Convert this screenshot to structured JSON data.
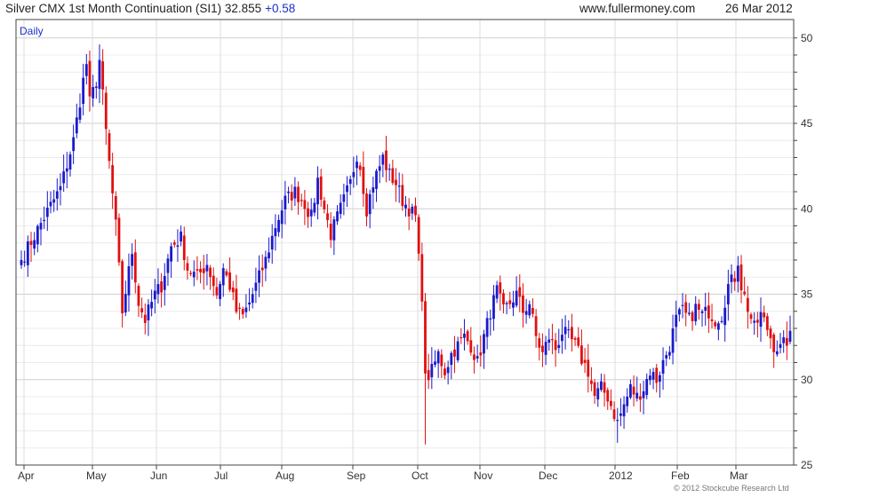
{
  "header": {
    "title": "Silver CMX 1st Month Continuation (SI1) 32.855",
    "change": "+0.58",
    "site": "www.fullermoney.com",
    "date": "26 Mar 2012"
  },
  "period_label": "Daily",
  "copyright": "© 2012 Stockcube Research Ltd",
  "colors": {
    "up": "#1a1acc",
    "down": "#e01010",
    "grid": "#dddddd",
    "frame": "#444444"
  },
  "chart_data": {
    "type": "candlestick",
    "x_ticks": [
      "Apr",
      "May",
      "Jun",
      "Jul",
      "Aug",
      "Sep",
      "Oct",
      "Nov",
      "Dec",
      "2012",
      "Feb",
      "Mar"
    ],
    "y_ticks": [
      "25",
      "30",
      "35",
      "40",
      "45",
      "50"
    ],
    "ylim": [
      25,
      50.2
    ],
    "grid": true,
    "anchors": [
      {
        "i": 0,
        "v": 37.0
      },
      {
        "i": 7,
        "v": 39.5
      },
      {
        "i": 12,
        "v": 41.2
      },
      {
        "i": 16,
        "v": 44.0
      },
      {
        "i": 19,
        "v": 47.5
      },
      {
        "i": 20,
        "v": 48.5
      },
      {
        "i": 21,
        "v": 46.2
      },
      {
        "i": 23,
        "v": 47.5
      },
      {
        "i": 24,
        "v": 48.7
      },
      {
        "i": 26,
        "v": 44.5
      },
      {
        "i": 29,
        "v": 39.0
      },
      {
        "i": 31,
        "v": 34.0
      },
      {
        "i": 34,
        "v": 37.5
      },
      {
        "i": 36,
        "v": 34.5
      },
      {
        "i": 38,
        "v": 33.5
      },
      {
        "i": 41,
        "v": 35.0
      },
      {
        "i": 43,
        "v": 35.5
      },
      {
        "i": 46,
        "v": 37.8
      },
      {
        "i": 49,
        "v": 38.3
      },
      {
        "i": 51,
        "v": 36.5
      },
      {
        "i": 54,
        "v": 36.0
      },
      {
        "i": 57,
        "v": 36.8
      },
      {
        "i": 60,
        "v": 35.0
      },
      {
        "i": 62,
        "v": 36.5
      },
      {
        "i": 64,
        "v": 35.5
      },
      {
        "i": 66,
        "v": 34.0
      },
      {
        "i": 68,
        "v": 33.7
      },
      {
        "i": 70,
        "v": 34.5
      },
      {
        "i": 73,
        "v": 36.0
      },
      {
        "i": 75,
        "v": 37.0
      },
      {
        "i": 78,
        "v": 39.0
      },
      {
        "i": 81,
        "v": 40.5
      },
      {
        "i": 84,
        "v": 41.0
      },
      {
        "i": 87,
        "v": 40.3
      },
      {
        "i": 89,
        "v": 39.5
      },
      {
        "i": 91,
        "v": 41.7
      },
      {
        "i": 93,
        "v": 40.0
      },
      {
        "i": 95,
        "v": 38.5
      },
      {
        "i": 97,
        "v": 39.5
      },
      {
        "i": 99,
        "v": 40.5
      },
      {
        "i": 101,
        "v": 41.5
      },
      {
        "i": 103,
        "v": 43.2
      },
      {
        "i": 104,
        "v": 42.5
      },
      {
        "i": 106,
        "v": 40.0
      },
      {
        "i": 108,
        "v": 41.5
      },
      {
        "i": 111,
        "v": 43.0
      },
      {
        "i": 113,
        "v": 42.0
      },
      {
        "i": 115,
        "v": 41.5
      },
      {
        "i": 117,
        "v": 40.5
      },
      {
        "i": 119,
        "v": 40.0
      },
      {
        "i": 121,
        "v": 39.5
      },
      {
        "i": 122,
        "v": 37.0
      },
      {
        "i": 123,
        "v": 35.0
      },
      {
        "i": 124,
        "v": 30.0
      },
      {
        "i": 126,
        "v": 30.5
      },
      {
        "i": 128,
        "v": 31.5
      },
      {
        "i": 130,
        "v": 30.5
      },
      {
        "i": 132,
        "v": 31.5
      },
      {
        "i": 134,
        "v": 32.0
      },
      {
        "i": 136,
        "v": 32.5
      },
      {
        "i": 138,
        "v": 32.0
      },
      {
        "i": 140,
        "v": 31.0
      },
      {
        "i": 142,
        "v": 32.5
      },
      {
        "i": 144,
        "v": 34.0
      },
      {
        "i": 146,
        "v": 35.2
      },
      {
        "i": 148,
        "v": 34.0
      },
      {
        "i": 150,
        "v": 34.5
      },
      {
        "i": 152,
        "v": 35.0
      },
      {
        "i": 154,
        "v": 34.0
      },
      {
        "i": 156,
        "v": 34.5
      },
      {
        "i": 158,
        "v": 32.5
      },
      {
        "i": 160,
        "v": 31.5
      },
      {
        "i": 162,
        "v": 32.5
      },
      {
        "i": 164,
        "v": 31.8
      },
      {
        "i": 166,
        "v": 32.8
      },
      {
        "i": 168,
        "v": 32.5
      },
      {
        "i": 170,
        "v": 32.0
      },
      {
        "i": 172,
        "v": 31.2
      },
      {
        "i": 174,
        "v": 30.5
      },
      {
        "i": 176,
        "v": 29.0
      },
      {
        "i": 178,
        "v": 29.5
      },
      {
        "i": 180,
        "v": 29.0
      },
      {
        "i": 182,
        "v": 28.0
      },
      {
        "i": 183,
        "v": 27.5
      },
      {
        "i": 185,
        "v": 28.5
      },
      {
        "i": 187,
        "v": 29.5
      },
      {
        "i": 189,
        "v": 29.0
      },
      {
        "i": 191,
        "v": 29.5
      },
      {
        "i": 193,
        "v": 30.5
      },
      {
        "i": 195,
        "v": 30.0
      },
      {
        "i": 197,
        "v": 31.0
      },
      {
        "i": 199,
        "v": 32.0
      },
      {
        "i": 201,
        "v": 33.5
      },
      {
        "i": 203,
        "v": 34.0
      },
      {
        "i": 205,
        "v": 33.5
      },
      {
        "i": 207,
        "v": 34.2
      },
      {
        "i": 209,
        "v": 33.8
      },
      {
        "i": 211,
        "v": 34.0
      },
      {
        "i": 213,
        "v": 33.5
      },
      {
        "i": 215,
        "v": 33.8
      },
      {
        "i": 217,
        "v": 35.5
      },
      {
        "i": 219,
        "v": 36.0
      },
      {
        "i": 220,
        "v": 37.0
      },
      {
        "i": 221,
        "v": 35.5
      },
      {
        "i": 223,
        "v": 34.2
      },
      {
        "i": 225,
        "v": 33.0
      },
      {
        "i": 227,
        "v": 33.8
      },
      {
        "i": 229,
        "v": 33.0
      },
      {
        "i": 231,
        "v": 32.0
      },
      {
        "i": 233,
        "v": 31.8
      },
      {
        "i": 235,
        "v": 32.3
      },
      {
        "i": 236,
        "v": 32.855
      }
    ]
  }
}
